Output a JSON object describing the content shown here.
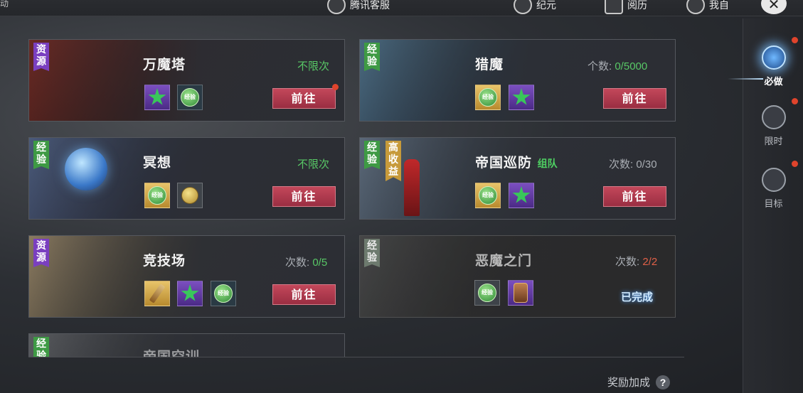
{
  "topbar": {
    "corner_text": "动",
    "items": [
      {
        "label": "腾讯客服",
        "icon": "headset-icon"
      },
      {
        "label": "纪元",
        "icon": "compass-icon"
      },
      {
        "label": "阅历",
        "icon": "book-icon"
      },
      {
        "label": "我自",
        "icon": "helmet-icon"
      }
    ],
    "close_label": "✕"
  },
  "nav": [
    {
      "label": "必做",
      "icon": "sword-shield-icon",
      "active": true
    },
    {
      "label": "限时",
      "icon": "trident-icon",
      "active": false
    },
    {
      "label": "目标",
      "icon": "skull-icon",
      "active": false
    }
  ],
  "cards": [
    {
      "title": "万魔塔",
      "tags": [
        "资源"
      ],
      "count_text": "不限次",
      "button": "前往",
      "rewards": [
        "star",
        "coin-dark"
      ]
    },
    {
      "title": "猎魔",
      "tags": [
        "经验"
      ],
      "count_label": "个数:",
      "count_value": "0/5000",
      "button": "前往",
      "rewards": [
        "coin-gold",
        "star"
      ]
    },
    {
      "title": "冥想",
      "tags": [
        "经验"
      ],
      "count_text": "不限次",
      "button": "前往",
      "rewards": [
        "coin-gold",
        "gold-coin"
      ]
    },
    {
      "title": "帝国巡防",
      "subtitle": "组队",
      "tags": [
        "经验",
        "高收益"
      ],
      "count_label": "次数:",
      "count_value": "0/30",
      "button": "前往",
      "rewards": [
        "coin-gold",
        "star"
      ]
    },
    {
      "title": "竞技场",
      "tags": [
        "资源"
      ],
      "count_label": "次数:",
      "count_value": "0/5",
      "button": "前往",
      "rewards": [
        "sword",
        "star",
        "coin-dark"
      ]
    },
    {
      "title": "恶魔之门",
      "tags": [
        "经验"
      ],
      "count_label": "次数:",
      "count_value": "2/2",
      "status": "已完成",
      "rewards": [
        "coin-gray",
        "amulet"
      ]
    },
    {
      "title": "帝国空训",
      "tags": [
        "经验"
      ]
    }
  ],
  "reward_coin_label": "经验",
  "footer": {
    "bonus_label": "奖励加成",
    "help_label": "?"
  },
  "colors": {
    "go_button": "#b23a4e",
    "accent_green": "#58c866",
    "done_glow": "#4fa0ff",
    "alert_dot": "#e0442c"
  }
}
